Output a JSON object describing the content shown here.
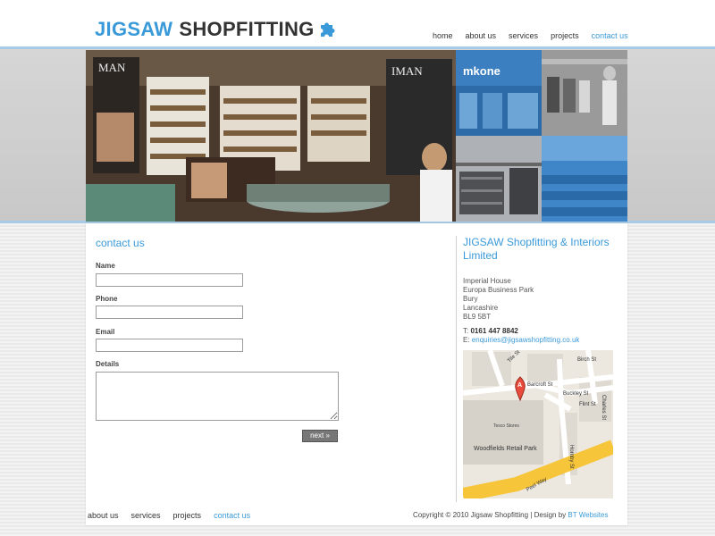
{
  "brand": {
    "name_part1": "JIGSAW",
    "name_part2": "SHOPFITTING",
    "color_part1": "#3a9ad9",
    "color_part2": "#333333"
  },
  "top_nav": [
    {
      "label": "home",
      "active": false
    },
    {
      "label": "about us",
      "active": false
    },
    {
      "label": "services",
      "active": false
    },
    {
      "label": "projects",
      "active": false
    },
    {
      "label": "contact us",
      "active": true
    }
  ],
  "hero": {
    "main_sign_left": "MAN",
    "main_sign_right": "IMAN",
    "tile_store_sign": "mkone"
  },
  "contact_form": {
    "heading": "contact us",
    "name_label": "Name",
    "name_value": "",
    "phone_label": "Phone",
    "phone_value": "",
    "email_label": "Email",
    "email_value": "",
    "details_label": "Details",
    "details_value": "",
    "submit_label": "next »"
  },
  "company": {
    "name": "JIGSAW Shopfitting & Interiors Limited",
    "address_lines": [
      "Imperial House",
      "Europa Business Park",
      "Bury",
      "Lancashire",
      "BL9 5BT"
    ],
    "phone_prefix": "T:",
    "phone": "0161 447 8842",
    "email_prefix": "E:",
    "email": "enquiries@jigsawshopfitting.co.uk"
  },
  "map": {
    "marker_letter": "A",
    "streets": [
      "Tile St",
      "Birch St",
      "Barcroft St",
      "Charles St",
      "Buckley St",
      "Flint St",
      "Hornby St",
      "Peel Way"
    ],
    "poi_tesco": "Tesco Stores",
    "poi_retail": "Woodfields Retail Park"
  },
  "footer": {
    "nav": [
      {
        "label": "about us",
        "active": false
      },
      {
        "label": "services",
        "active": false
      },
      {
        "label": "projects",
        "active": false
      },
      {
        "label": "contact us",
        "active": true
      }
    ],
    "copyright": "Copyright © 2010 Jigsaw Shopfitting | Design by",
    "credit": "BT Websites"
  },
  "colors": {
    "accent": "#3a9ad9",
    "rule": "#a9cbe6",
    "nav_text": "#333333"
  }
}
